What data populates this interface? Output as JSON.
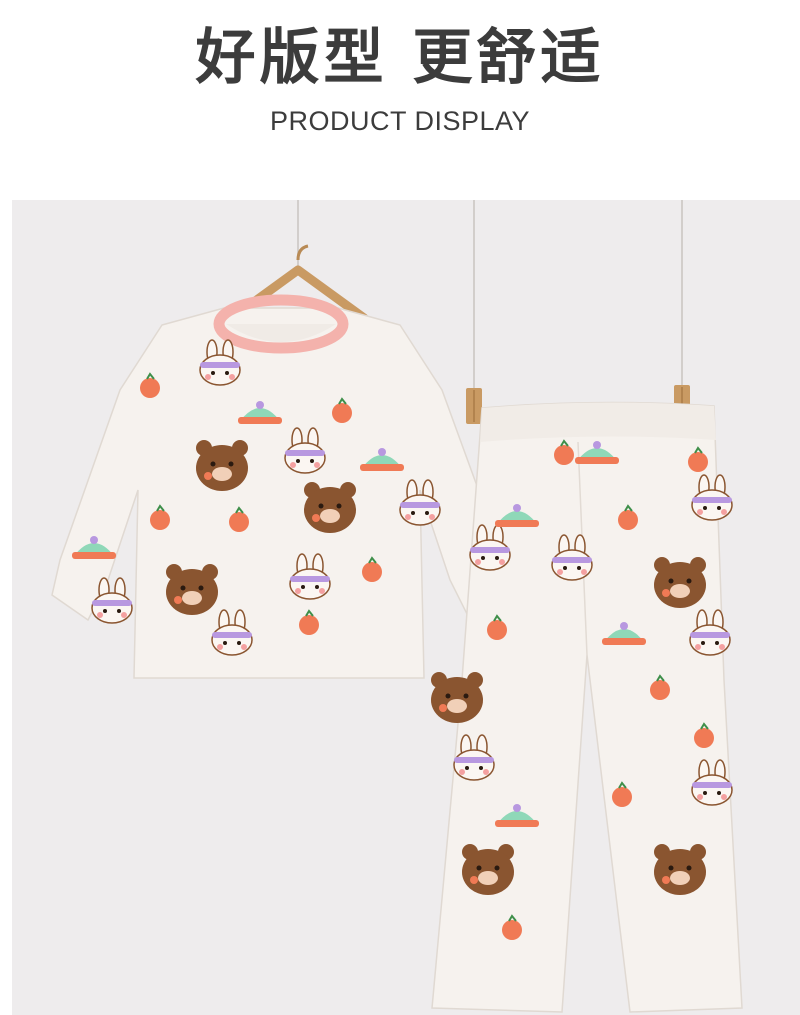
{
  "header": {
    "title": "好版型 更舒适",
    "subtitle": "PRODUCT DISPLAY"
  },
  "photo": {
    "background_color": "#eeeced",
    "fabric_color": "#f6f2ee",
    "collar_color": "#f4b2ac",
    "print_colors": [
      "#f07a55",
      "#8a5530",
      "#b898e0",
      "#8fd8b8"
    ]
  }
}
